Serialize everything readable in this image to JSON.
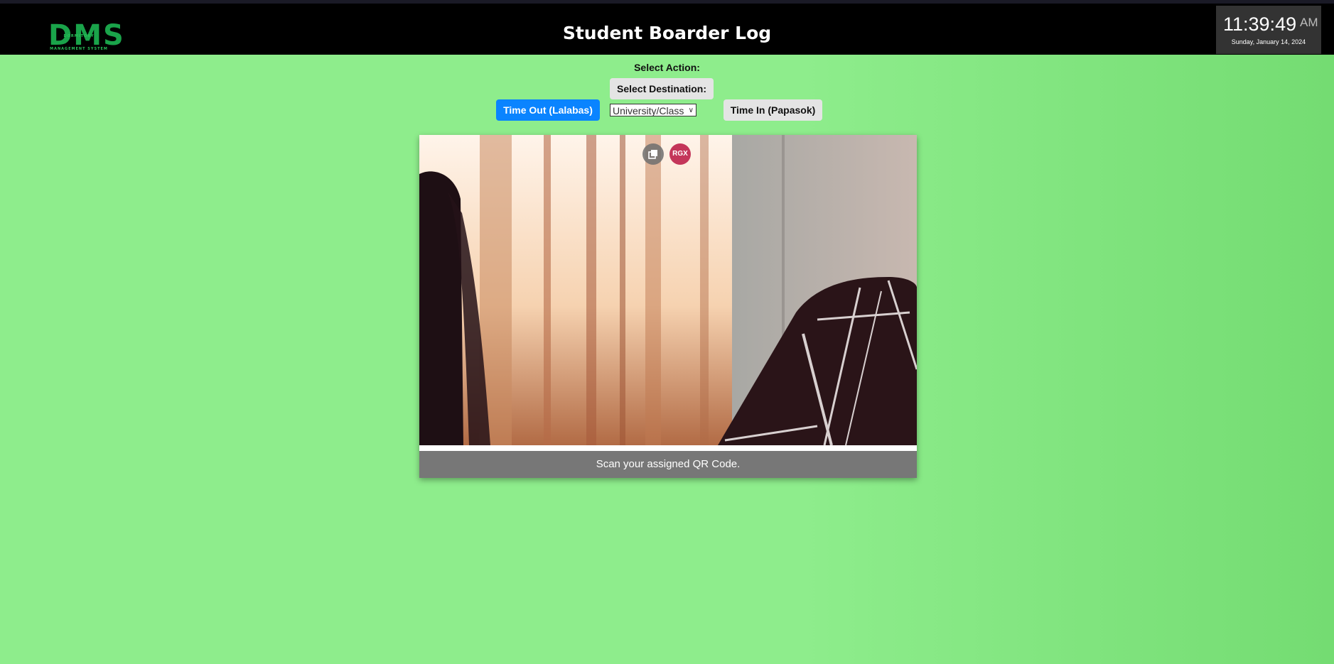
{
  "header": {
    "logo": {
      "main": "DMS",
      "line1": "DORMITORY",
      "line2": "MANAGEMENT SYSTEM"
    },
    "title": "Student Boarder Log",
    "clock": {
      "time": "11:39:49",
      "ampm": "AM",
      "date": "Sunday, January 14, 2024"
    }
  },
  "controls": {
    "select_action_label": "Select Action:",
    "select_destination_label": "Select Destination:",
    "time_out_label": "Time Out (Lalabas)",
    "time_in_label": "Time In (Papasok)",
    "destination_selected": "University/Class"
  },
  "scanner": {
    "overlay_buttons": {
      "copy_icon": "copy-icon",
      "rgx_label": "RGX"
    },
    "status": "Scan your assigned QR Code."
  },
  "colors": {
    "background": "#8eed8c",
    "header": "#000000",
    "time_out_button": "#0a84ff",
    "logo_green": "#1aa34a",
    "status_bar": "#777777",
    "rgx_badge": "#c4365a"
  }
}
